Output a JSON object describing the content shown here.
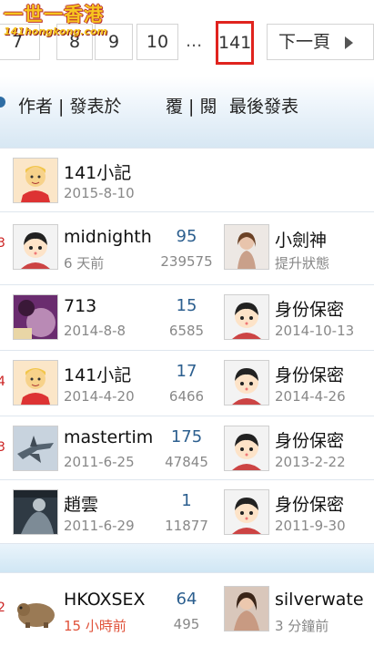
{
  "logo": {
    "title": "一世一香港",
    "subtitle": "141hongkong.com"
  },
  "pager": {
    "pages": [
      "7",
      "8",
      "9",
      "10"
    ],
    "ellipsis": "...",
    "current": "141",
    "next": "下一頁"
  },
  "header": {
    "author": "作者 | 發表於",
    "reply_views": "覆 | 閱",
    "last_post": "最後發表"
  },
  "threads": [
    {
      "author": "141小記",
      "date": "2015-8-10",
      "replies": "",
      "views": "",
      "last_user": "",
      "last_time": ""
    },
    {
      "author": "midnighth",
      "date": "6 天前",
      "replies": "95",
      "views": "239575",
      "last_user": "小劍神",
      "last_time": "提升狀態"
    },
    {
      "author": "713",
      "date": "2014-8-8",
      "replies": "15",
      "views": "6585",
      "last_user": "身份保密",
      "last_time": "2014-10-13"
    },
    {
      "author": "141小記",
      "date": "2014-4-20",
      "replies": "17",
      "views": "6466",
      "last_user": "身份保密",
      "last_time": "2014-4-26"
    },
    {
      "author": "mastertim",
      "date": "2011-6-25",
      "replies": "175",
      "views": "47845",
      "last_user": "身份保密",
      "last_time": "2013-2-22"
    },
    {
      "author": "趙雲",
      "date": "2011-6-29",
      "replies": "1",
      "views": "11877",
      "last_user": "身份保密",
      "last_time": "2011-9-30"
    },
    {
      "author": "HKOXSEX",
      "date": "15 小時前",
      "replies": "64",
      "views": "495",
      "last_user": "silverwate",
      "last_time": "3 分鐘前"
    }
  ],
  "colors": {
    "current_page_border": "#e0231e",
    "reply_count": "#2c5f8f",
    "recent_time": "#e0523a"
  }
}
